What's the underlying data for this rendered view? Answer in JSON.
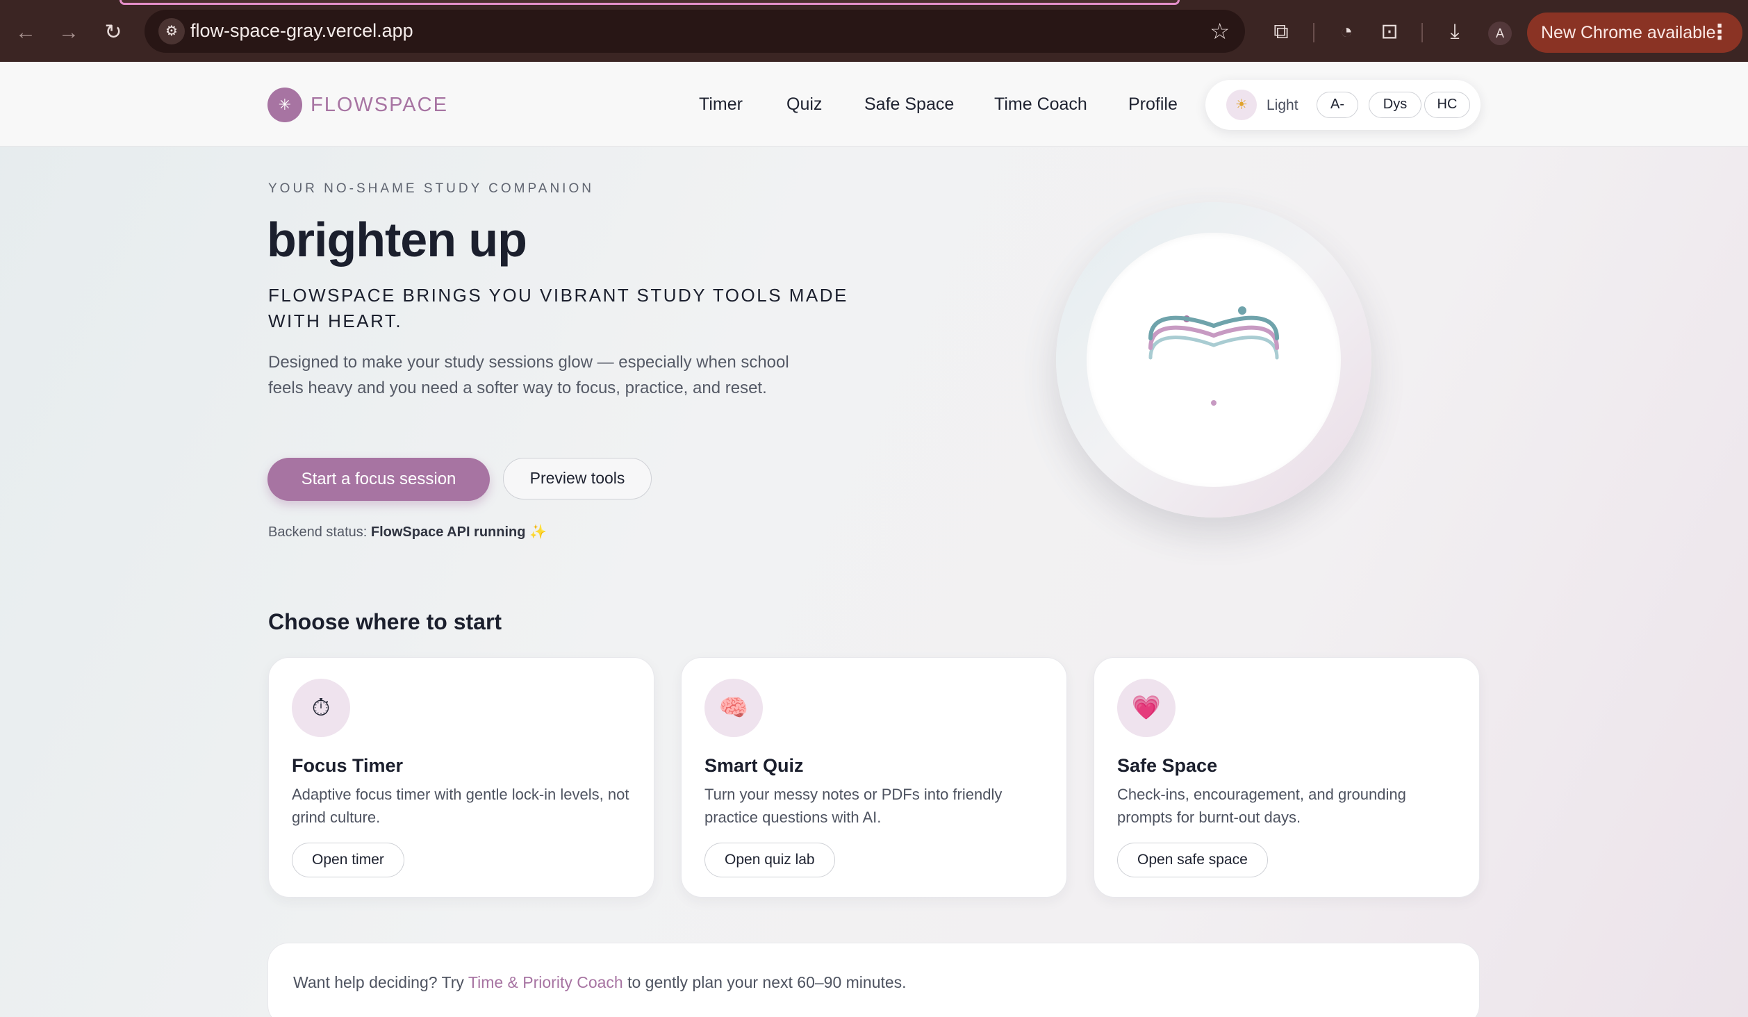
{
  "browser": {
    "url": "flow-space-gray.vercel.app",
    "update_label": "New Chrome available",
    "profile_initial": "A"
  },
  "header": {
    "brand": "FLOWSPACE",
    "nav": [
      "Timer",
      "Quiz",
      "Safe Space",
      "Time Coach",
      "Profile"
    ],
    "a11y": {
      "theme_label": "Light",
      "font_size": "A-",
      "dyslexia": "Dys",
      "high_contrast": "HC"
    }
  },
  "hero": {
    "eyebrow": "YOUR NO-SHAME STUDY COMPANION",
    "title": "brighten up",
    "subtitle": "FLOWSPACE BRINGS YOU VIBRANT STUDY TOOLS MADE WITH HEART.",
    "description": "Designed to make your study sessions glow — especially when school feels heavy and you need a softer way to focus, practice, and reset.",
    "primary_cta": "Start a focus session",
    "secondary_cta": "Preview tools",
    "backend_label": "Backend status:",
    "backend_status": "FlowSpace API running",
    "backend_emoji": "✨"
  },
  "section": {
    "title": "Choose where to start",
    "cards": [
      {
        "icon": "⏱",
        "title": "Focus Timer",
        "description": "Adaptive focus timer with gentle lock-in levels, not grind culture.",
        "button": "Open timer"
      },
      {
        "icon": "🧠",
        "title": "Smart Quiz",
        "description": "Turn your messy notes or PDFs into friendly practice questions with AI.",
        "button": "Open quiz lab"
      },
      {
        "icon": "💗",
        "title": "Safe Space",
        "description": "Check-ins, encouragement, and grounding prompts for burnt-out days.",
        "button": "Open safe space"
      }
    ]
  },
  "help": {
    "prefix": "Want help deciding? Try",
    "link": "Time & Priority Coach",
    "suffix": "to gently plan your next 60–90 minutes."
  },
  "colors": {
    "accent": "#a774a2",
    "teal": "#6fa3ab",
    "light_teal": "#a9ccd2",
    "pink": "#c79ac2"
  }
}
